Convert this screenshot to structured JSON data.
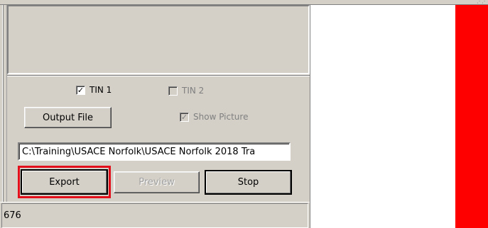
{
  "options": {
    "tin1": {
      "label": "TIN 1",
      "checked": true,
      "enabled": true
    },
    "tin2": {
      "label": "TIN 2",
      "checked": false,
      "enabled": false
    },
    "show_picture": {
      "label": "Show Picture",
      "checked": true,
      "enabled": false
    }
  },
  "buttons": {
    "output_file": "Output File",
    "export": "Export",
    "preview": "Preview",
    "stop": "Stop"
  },
  "output_path": "C:\\Training\\USACE Norfolk\\USACE Norfolk 2018 Tra",
  "status": {
    "text": "676"
  },
  "colors": {
    "highlight": "#e3101c",
    "canvas_fill": "#ff0000",
    "canvas_bg": "#ffffff"
  },
  "icons": {
    "check": "✓"
  }
}
